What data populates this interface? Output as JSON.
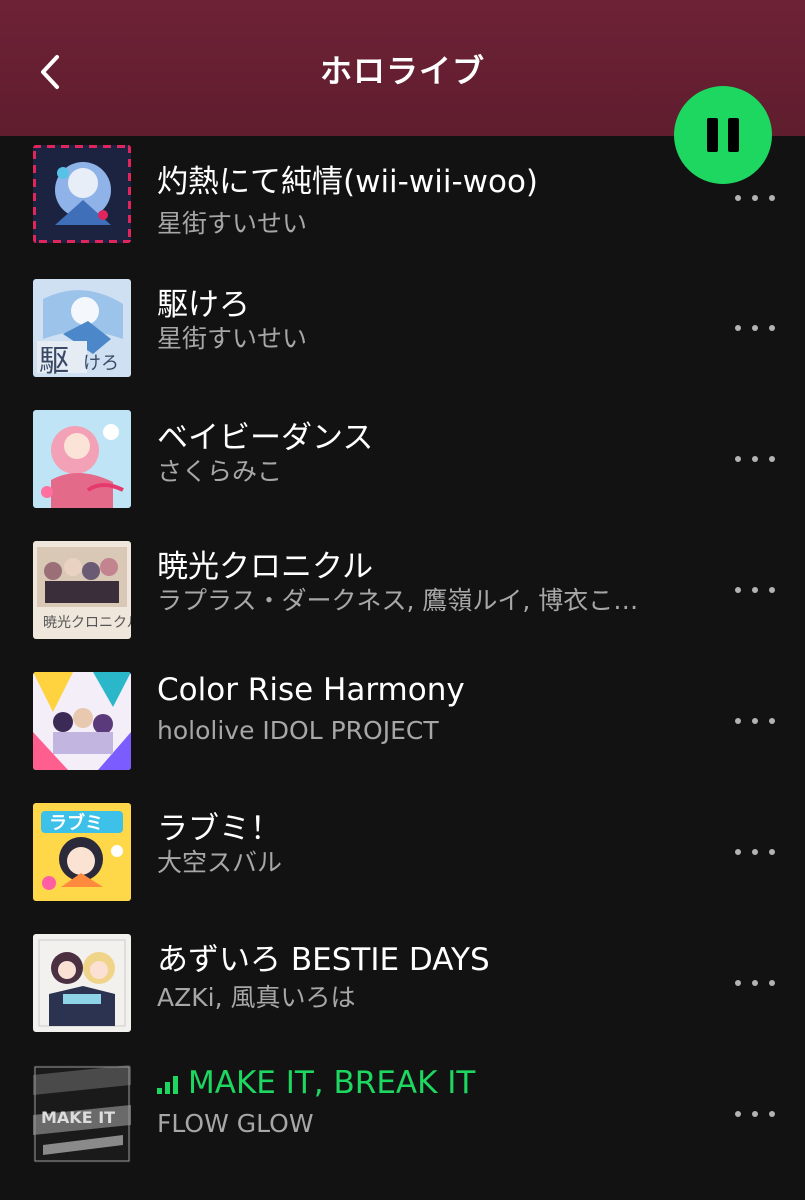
{
  "header": {
    "title": "ホロライブ",
    "back_icon": "chevron-left-icon",
    "pause_icon": "pause-icon",
    "accent": "#1ed760"
  },
  "tracks": [
    {
      "title": "灼熱にて純情(wii-wii-woo)",
      "artist": "星街すいせい",
      "playing": false
    },
    {
      "title": "駆けろ",
      "artist": "星街すいせい",
      "playing": false
    },
    {
      "title": "ベイビーダンス",
      "artist": "さくらみこ",
      "playing": false
    },
    {
      "title": "暁光クロニクル",
      "artist": "ラプラス・ダークネス, 鷹嶺ルイ, 博衣こ…",
      "playing": false
    },
    {
      "title": "Color Rise Harmony",
      "artist": "hololive IDOL PROJECT",
      "playing": false
    },
    {
      "title": "ラブミ！",
      "artist": "大空スバル",
      "playing": false
    },
    {
      "title": "あずいろ BESTIE DAYS",
      "artist": "AZKi, 風真いろは",
      "playing": false
    },
    {
      "title": "MAKE IT, BREAK IT",
      "artist": "FLOW GLOW",
      "playing": true
    }
  ]
}
